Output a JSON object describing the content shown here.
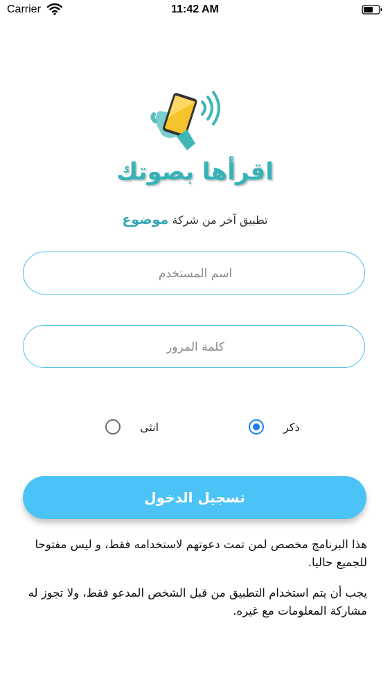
{
  "status_bar": {
    "carrier": "Carrier",
    "time": "11:42 AM"
  },
  "branding": {
    "app_name": "اقرأها بصوتك",
    "tagline_prefix": "تطبيق آخر من شركة",
    "company": "موضوع",
    "accent_color": "#35b3b8"
  },
  "form": {
    "username_placeholder": "اسم المستخدم",
    "password_placeholder": "كلمة المرور",
    "gender": {
      "male_label": "ذكر",
      "female_label": "انثى",
      "selected": "ذكر"
    },
    "login_label": "تسجيل الدخول",
    "button_color": "#4cc3f6"
  },
  "notices": {
    "line1": "هذا البرنامج مخصص لمن تمت دعوتهم لاستخدامه فقط، و ليس مفتوحا للجميع حاليا.",
    "line2": "يجب أن يتم استخدام التطبيق من قبل الشخص المدعو فقط، ولا تجوز له مشاركة المعلومات مع غيره."
  },
  "icons": {
    "wifi": "wifi-icon",
    "battery": "battery-icon",
    "logo": "hand-phone-sound-icon"
  }
}
